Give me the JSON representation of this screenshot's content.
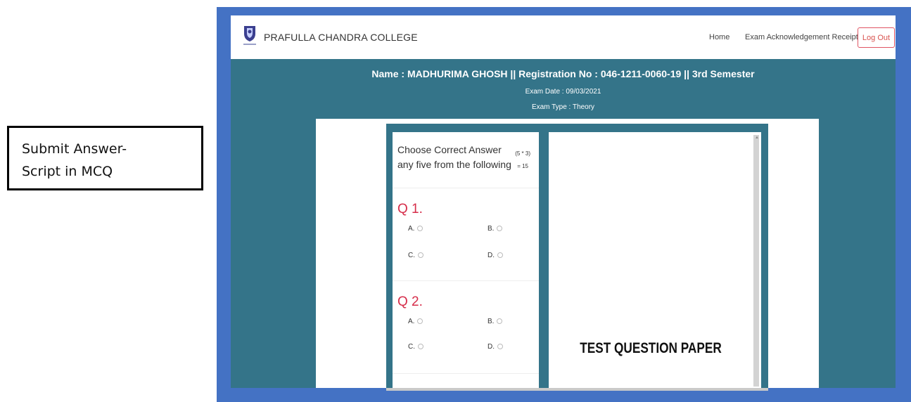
{
  "caption": {
    "line1": "Submit Answer-",
    "line2": "Script in MCQ"
  },
  "navbar": {
    "brand": "PRAFULLA CHANDRA COLLEGE",
    "home": "Home",
    "receipt": "Exam Acknowledgement Receipt",
    "logout": "Log Out"
  },
  "header": {
    "student_line": "Name : MADHURIMA GHOSH || Registration No : 046-1211-0060-19 || 3rd Semester",
    "exam_date": "Exam Date : 09/03/2021",
    "exam_type": "Exam Type : Theory"
  },
  "mcq": {
    "instruction": "Choose Correct Answer any five from the following",
    "marks_top": "(5 * 3)",
    "marks_bottom": "= 15",
    "questions": [
      {
        "number": "Q 1.",
        "options": [
          "A.",
          "B.",
          "C.",
          "D."
        ]
      },
      {
        "number": "Q 2.",
        "options": [
          "A.",
          "B.",
          "C.",
          "D."
        ]
      }
    ]
  },
  "question_paper": {
    "title": "TEST QUESTION PAPER"
  },
  "colors": {
    "frame": "#4472c4",
    "main": "#347489",
    "question_number": "#d62d4a",
    "logout": "#d9534f"
  }
}
